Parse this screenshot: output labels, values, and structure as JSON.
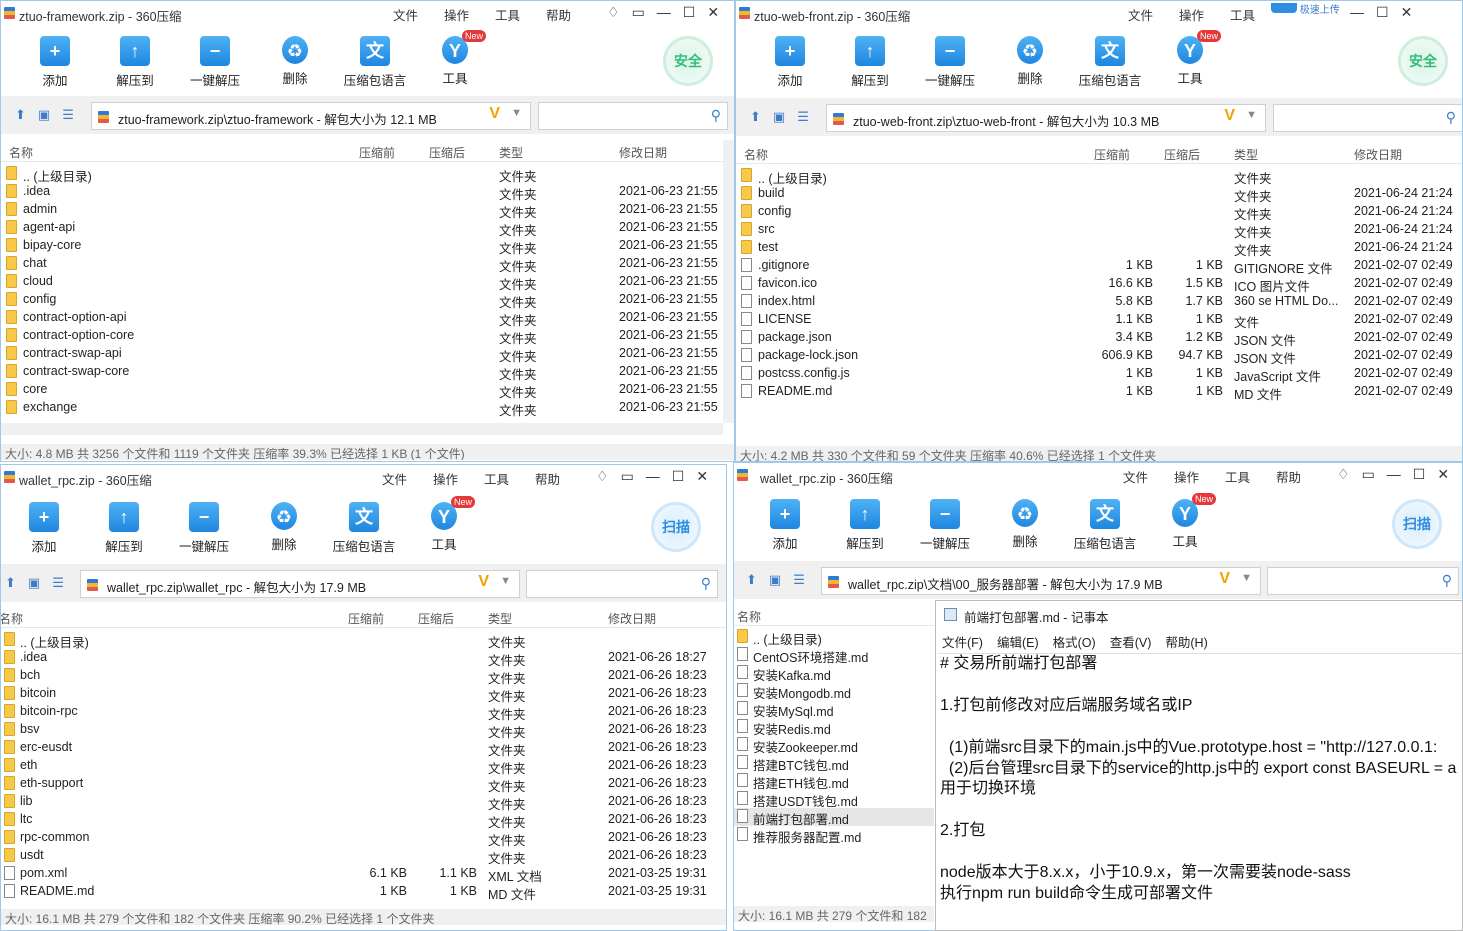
{
  "ui": {
    "menus": [
      "文件",
      "操作",
      "工具",
      "帮助"
    ],
    "tools": [
      "添加",
      "解压到",
      "一键解压",
      "删除",
      "压缩包语言",
      "工具"
    ],
    "new_badge": "New",
    "safe_label": "安全",
    "scan_label": "扫描",
    "cloud_label": "极速上传",
    "columns": [
      "名称",
      "压缩前",
      "压缩后",
      "类型",
      "修改日期"
    ],
    "colors": {
      "accent": "#1e86df",
      "folder": "#f6c94a",
      "status_bg": "#f0f0f0"
    }
  },
  "windows": [
    {
      "title": "ztuo-framework.zip - 360压缩",
      "address": "ztuo-framework.zip\\ztuo-framework - 解包大小为 12.1 MB",
      "status": "大小: 4.8 MB 共 3256 个文件和 1119 个文件夹 压缩率 39.3% 已经选择 1 KB (1 个文件)",
      "rows": [
        {
          "name": ".. (上级目录)",
          "before": "",
          "after": "",
          "type": "文件夹",
          "date": "",
          "kind": "folder"
        },
        {
          "name": ".idea",
          "before": "",
          "after": "",
          "type": "文件夹",
          "date": "2021-06-23 21:55",
          "kind": "folder"
        },
        {
          "name": "admin",
          "before": "",
          "after": "",
          "type": "文件夹",
          "date": "2021-06-23 21:55",
          "kind": "folder"
        },
        {
          "name": "agent-api",
          "before": "",
          "after": "",
          "type": "文件夹",
          "date": "2021-06-23 21:55",
          "kind": "folder"
        },
        {
          "name": "bipay-core",
          "before": "",
          "after": "",
          "type": "文件夹",
          "date": "2021-06-23 21:55",
          "kind": "folder"
        },
        {
          "name": "chat",
          "before": "",
          "after": "",
          "type": "文件夹",
          "date": "2021-06-23 21:55",
          "kind": "folder"
        },
        {
          "name": "cloud",
          "before": "",
          "after": "",
          "type": "文件夹",
          "date": "2021-06-23 21:55",
          "kind": "folder"
        },
        {
          "name": "config",
          "before": "",
          "after": "",
          "type": "文件夹",
          "date": "2021-06-23 21:55",
          "kind": "folder"
        },
        {
          "name": "contract-option-api",
          "before": "",
          "after": "",
          "type": "文件夹",
          "date": "2021-06-23 21:55",
          "kind": "folder"
        },
        {
          "name": "contract-option-core",
          "before": "",
          "after": "",
          "type": "文件夹",
          "date": "2021-06-23 21:55",
          "kind": "folder"
        },
        {
          "name": "contract-swap-api",
          "before": "",
          "after": "",
          "type": "文件夹",
          "date": "2021-06-23 21:55",
          "kind": "folder"
        },
        {
          "name": "contract-swap-core",
          "before": "",
          "after": "",
          "type": "文件夹",
          "date": "2021-06-23 21:55",
          "kind": "folder"
        },
        {
          "name": "core",
          "before": "",
          "after": "",
          "type": "文件夹",
          "date": "2021-06-23 21:55",
          "kind": "folder"
        },
        {
          "name": "exchange",
          "before": "",
          "after": "",
          "type": "文件夹",
          "date": "2021-06-23 21:55",
          "kind": "folder"
        }
      ]
    },
    {
      "title": "ztuo-web-front.zip - 360压缩",
      "address": "ztuo-web-front.zip\\ztuo-web-front - 解包大小为 10.3 MB",
      "status": "大小: 4.2 MB 共 330 个文件和 59 个文件夹 压缩率 40.6% 已经选择 1 个文件夹",
      "rows": [
        {
          "name": ".. (上级目录)",
          "before": "",
          "after": "",
          "type": "文件夹",
          "date": "",
          "kind": "folder"
        },
        {
          "name": "build",
          "before": "",
          "after": "",
          "type": "文件夹",
          "date": "2021-06-24 21:24",
          "kind": "folder"
        },
        {
          "name": "config",
          "before": "",
          "after": "",
          "type": "文件夹",
          "date": "2021-06-24 21:24",
          "kind": "folder"
        },
        {
          "name": "src",
          "before": "",
          "after": "",
          "type": "文件夹",
          "date": "2021-06-24 21:24",
          "kind": "folder"
        },
        {
          "name": "test",
          "before": "",
          "after": "",
          "type": "文件夹",
          "date": "2021-06-24 21:24",
          "kind": "folder"
        },
        {
          "name": ".gitignore",
          "before": "1 KB",
          "after": "1 KB",
          "type": "GITIGNORE 文件",
          "date": "2021-02-07 02:49",
          "kind": "file"
        },
        {
          "name": "favicon.ico",
          "before": "16.6 KB",
          "after": "1.5 KB",
          "type": "ICO 图片文件",
          "date": "2021-02-07 02:49",
          "kind": "file"
        },
        {
          "name": "index.html",
          "before": "5.8 KB",
          "after": "1.7 KB",
          "type": "360 se HTML Do...",
          "date": "2021-02-07 02:49",
          "kind": "file"
        },
        {
          "name": "LICENSE",
          "before": "1.1 KB",
          "after": "1 KB",
          "type": "文件",
          "date": "2021-02-07 02:49",
          "kind": "file"
        },
        {
          "name": "package.json",
          "before": "3.4 KB",
          "after": "1.2 KB",
          "type": "JSON 文件",
          "date": "2021-02-07 02:49",
          "kind": "file"
        },
        {
          "name": "package-lock.json",
          "before": "606.9 KB",
          "after": "94.7 KB",
          "type": "JSON 文件",
          "date": "2021-02-07 02:49",
          "kind": "file"
        },
        {
          "name": "postcss.config.js",
          "before": "1 KB",
          "after": "1 KB",
          "type": "JavaScript 文件",
          "date": "2021-02-07 02:49",
          "kind": "file"
        },
        {
          "name": "README.md",
          "before": "1 KB",
          "after": "1 KB",
          "type": "MD 文件",
          "date": "2021-02-07 02:49",
          "kind": "file"
        }
      ]
    },
    {
      "title": "wallet_rpc.zip - 360压缩",
      "address": "wallet_rpc.zip\\wallet_rpc - 解包大小为 17.9 MB",
      "status": "大小: 16.1 MB 共 279 个文件和 182 个文件夹 压缩率 90.2% 已经选择 1 个文件夹",
      "rows": [
        {
          "name": ".. (上级目录)",
          "before": "",
          "after": "",
          "type": "文件夹",
          "date": "",
          "kind": "folder"
        },
        {
          "name": ".idea",
          "before": "",
          "after": "",
          "type": "文件夹",
          "date": "2021-06-26 18:27",
          "kind": "folder"
        },
        {
          "name": "bch",
          "before": "",
          "after": "",
          "type": "文件夹",
          "date": "2021-06-26 18:23",
          "kind": "folder"
        },
        {
          "name": "bitcoin",
          "before": "",
          "after": "",
          "type": "文件夹",
          "date": "2021-06-26 18:23",
          "kind": "folder"
        },
        {
          "name": "bitcoin-rpc",
          "before": "",
          "after": "",
          "type": "文件夹",
          "date": "2021-06-26 18:23",
          "kind": "folder"
        },
        {
          "name": "bsv",
          "before": "",
          "after": "",
          "type": "文件夹",
          "date": "2021-06-26 18:23",
          "kind": "folder"
        },
        {
          "name": "erc-eusdt",
          "before": "",
          "after": "",
          "type": "文件夹",
          "date": "2021-06-26 18:23",
          "kind": "folder"
        },
        {
          "name": "eth",
          "before": "",
          "after": "",
          "type": "文件夹",
          "date": "2021-06-26 18:23",
          "kind": "folder"
        },
        {
          "name": "eth-support",
          "before": "",
          "after": "",
          "type": "文件夹",
          "date": "2021-06-26 18:23",
          "kind": "folder"
        },
        {
          "name": "lib",
          "before": "",
          "after": "",
          "type": "文件夹",
          "date": "2021-06-26 18:23",
          "kind": "folder"
        },
        {
          "name": "ltc",
          "before": "",
          "after": "",
          "type": "文件夹",
          "date": "2021-06-26 18:23",
          "kind": "folder"
        },
        {
          "name": "rpc-common",
          "before": "",
          "after": "",
          "type": "文件夹",
          "date": "2021-06-26 18:23",
          "kind": "folder"
        },
        {
          "name": "usdt",
          "before": "",
          "after": "",
          "type": "文件夹",
          "date": "2021-06-26 18:23",
          "kind": "folder"
        },
        {
          "name": "pom.xml",
          "before": "6.1 KB",
          "after": "1.1 KB",
          "type": "XML 文档",
          "date": "2021-03-25 19:31",
          "kind": "file"
        },
        {
          "name": "README.md",
          "before": "1 KB",
          "after": "1 KB",
          "type": "MD 文件",
          "date": "2021-03-25 19:31",
          "kind": "file"
        }
      ]
    },
    {
      "title": "wallet_rpc.zip - 360压缩",
      "address": "wallet_rpc.zip\\文档\\00_服务器部署 - 解包大小为 17.9 MB",
      "status": "大小: 16.1 MB 共 279 个文件和 182",
      "rows": [
        {
          "name": ".. (上级目录)",
          "kind": "folder"
        },
        {
          "name": "CentOS环境搭建.md",
          "kind": "file"
        },
        {
          "name": "安装Kafka.md",
          "kind": "file"
        },
        {
          "name": "安装Mongodb.md",
          "kind": "file"
        },
        {
          "name": "安装MySql.md",
          "kind": "file"
        },
        {
          "name": "安装Redis.md",
          "kind": "file"
        },
        {
          "name": "安装Zookeeper.md",
          "kind": "file"
        },
        {
          "name": "搭建BTC钱包.md",
          "kind": "file"
        },
        {
          "name": "搭建ETH钱包.md",
          "kind": "file"
        },
        {
          "name": "搭建USDT钱包.md",
          "kind": "file"
        },
        {
          "name": "前端打包部署.md",
          "kind": "file"
        },
        {
          "name": "推荐服务器配置.md",
          "kind": "file"
        }
      ]
    }
  ],
  "notepad": {
    "title": "前端打包部署.md - 记事本",
    "menus": [
      "文件(F)",
      "编辑(E)",
      "格式(O)",
      "查看(V)",
      "帮助(H)"
    ],
    "content": "# 交易所前端打包部署\n\n1.打包前修改对应后端服务域名或IP\n\n  (1)前端src目录下的main.js中的Vue.prototype.host = \"http://127.0.0.1:\n  (2)后台管理src目录下的service的http.js中的 export const BASEURL = a\n用于切换环境\n\n2.打包\n\nnode版本大于8.x.x，小于10.9.x，第一次需要装node-sass\n执行npm run build命令生成可部署文件"
  }
}
